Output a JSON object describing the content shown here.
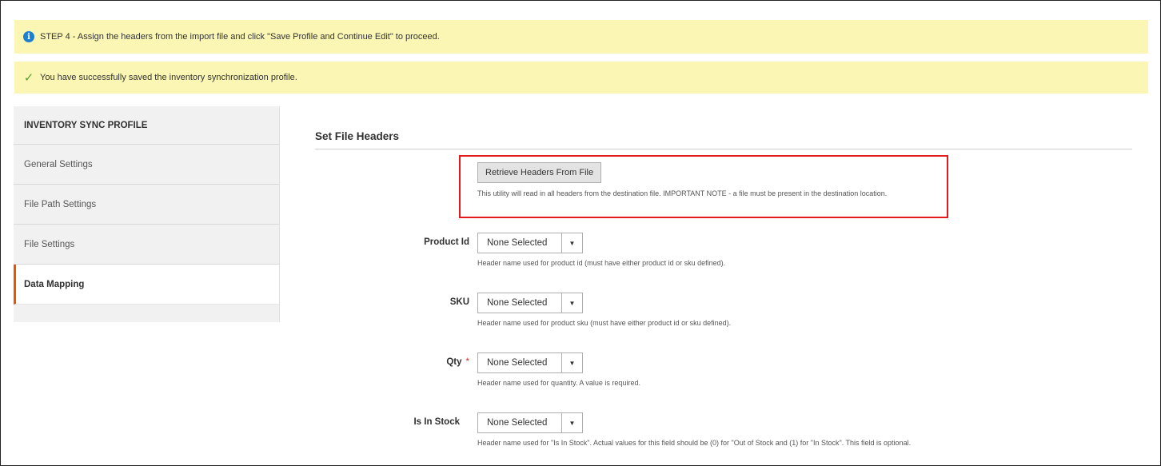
{
  "messages": {
    "info": "STEP 4 - Assign the headers from the import file and click \"Save Profile and Continue Edit\" to proceed.",
    "info_icon": "info-icon",
    "success": "You have successfully saved the inventory synchronization profile.",
    "success_icon": "checkmark-icon"
  },
  "sidebar": {
    "title": "INVENTORY SYNC PROFILE",
    "items": [
      {
        "label": "General Settings"
      },
      {
        "label": "File Path Settings"
      },
      {
        "label": "File Settings"
      },
      {
        "label": "Data Mapping",
        "active": true
      }
    ]
  },
  "main": {
    "section_title": "Set File Headers",
    "retrieve_button": "Retrieve Headers From File",
    "retrieve_note": "This utility will read in all headers from the destination file. IMPORTANT NOTE - a file must be present in the destination location.",
    "fields": [
      {
        "label": "Product Id",
        "value": "None Selected",
        "help": "Header name used for product id (must have either product id or sku defined).",
        "required": false
      },
      {
        "label": "SKU",
        "value": "None Selected",
        "help": "Header name used for product sku (must have either product id or sku defined).",
        "required": false
      },
      {
        "label": "Qty",
        "value": "None Selected",
        "help": "Header name used for quantity. A value is required.",
        "required": true,
        "required_mark": "*"
      },
      {
        "label": "Is In Stock",
        "value": "None Selected",
        "help": "Header name used for \"Is In Stock\". Actual values for this field should be (0) for \"Out of Stock and (1) for \"In Stock\". This field is optional.",
        "required": false
      }
    ]
  },
  "colors": {
    "message_bg": "#fbf6b4",
    "active_accent": "#eb5202",
    "highlight_border": "#e41b1b",
    "info_icon": "#1d7fd1",
    "success_icon": "#5c9e31",
    "required_mark": "#e22626"
  }
}
